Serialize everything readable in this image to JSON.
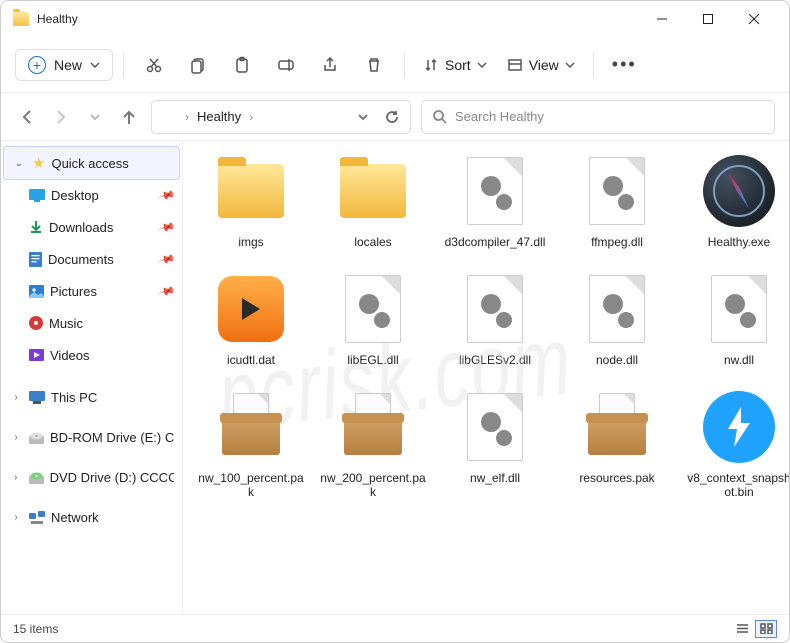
{
  "window": {
    "title": "Healthy",
    "search_placeholder": "Search Healthy"
  },
  "toolbar": {
    "new": "New",
    "sort": "Sort",
    "view": "View"
  },
  "breadcrumb": {
    "current": "Healthy"
  },
  "sidebar": {
    "quick_access": "Quick access",
    "items": [
      {
        "label": "Desktop"
      },
      {
        "label": "Downloads"
      },
      {
        "label": "Documents"
      },
      {
        "label": "Pictures"
      },
      {
        "label": "Music"
      },
      {
        "label": "Videos"
      }
    ],
    "this_pc": "This PC",
    "bdrom": "BD-ROM Drive (E:) C",
    "dvd": "DVD Drive (D:) CCCC",
    "network": "Network"
  },
  "files": [
    {
      "name": "imgs",
      "type": "folder"
    },
    {
      "name": "locales",
      "type": "folder"
    },
    {
      "name": "d3dcompiler_47.dll",
      "type": "dll"
    },
    {
      "name": "ffmpeg.dll",
      "type": "dll"
    },
    {
      "name": "Healthy.exe",
      "type": "compass"
    },
    {
      "name": "icudtl.dat",
      "type": "media"
    },
    {
      "name": "libEGL.dll",
      "type": "dll"
    },
    {
      "name": "libGLESv2.dll",
      "type": "dll"
    },
    {
      "name": "node.dll",
      "type": "dll"
    },
    {
      "name": "nw.dll",
      "type": "dll"
    },
    {
      "name": "nw_100_percent.pak",
      "type": "pak"
    },
    {
      "name": "nw_200_percent.pak",
      "type": "pak"
    },
    {
      "name": "nw_elf.dll",
      "type": "dll"
    },
    {
      "name": "resources.pak",
      "type": "pak"
    },
    {
      "name": "v8_context_snapshot.bin",
      "type": "bolt"
    }
  ],
  "status": {
    "count": "15 items"
  },
  "watermark": "pcrisk.com"
}
